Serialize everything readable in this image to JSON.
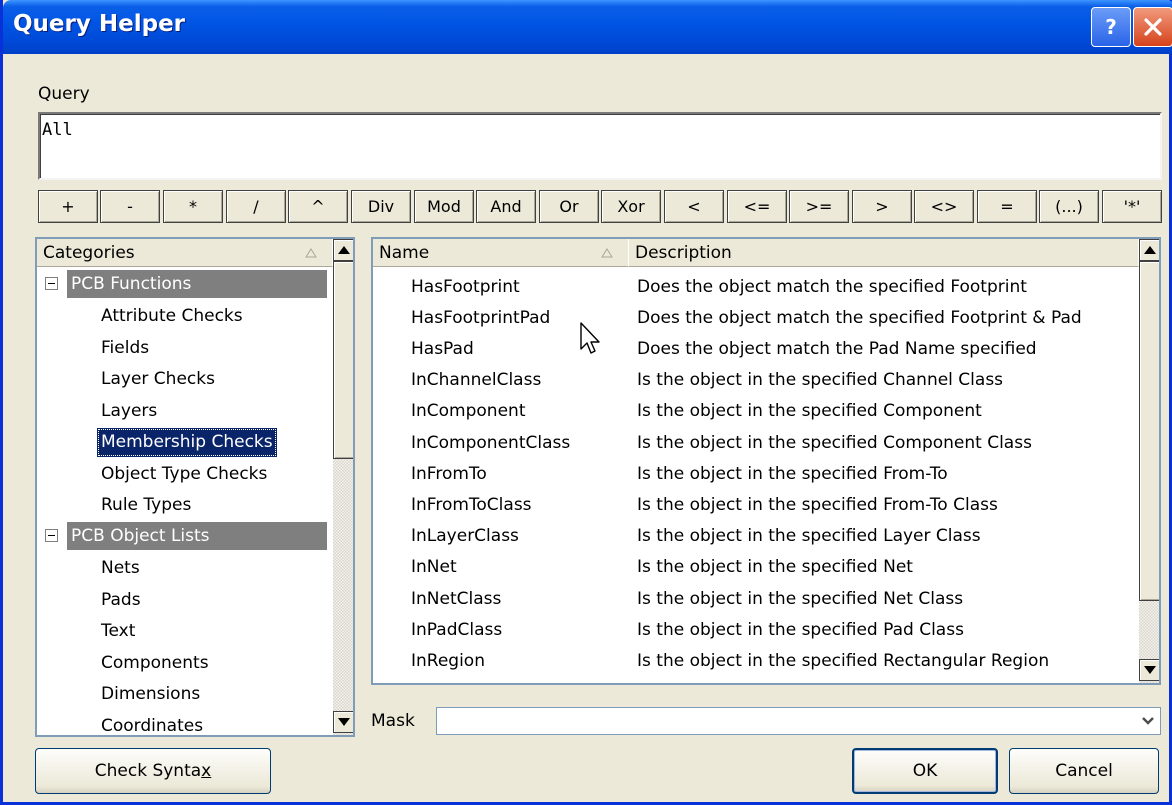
{
  "window": {
    "title": "Query Helper"
  },
  "query": {
    "label": "Query",
    "value": "All"
  },
  "operators": [
    "+",
    "-",
    "*",
    "/",
    "^",
    "Div",
    "Mod",
    "And",
    "Or",
    "Xor",
    "<",
    "<=",
    ">=",
    ">",
    "<>",
    "=",
    "(...)",
    "'*'"
  ],
  "categories": {
    "header": "Categories",
    "groups": [
      {
        "label": "PCB Functions",
        "items": [
          "Attribute Checks",
          "Fields",
          "Layer Checks",
          "Layers",
          "Membership Checks",
          "Object Type Checks",
          "Rule Types"
        ]
      },
      {
        "label": "PCB Object Lists",
        "items": [
          "Nets",
          "Pads",
          "Text",
          "Components",
          "Dimensions",
          "Coordinates"
        ]
      }
    ],
    "selected": "Membership Checks"
  },
  "functions": {
    "columns": {
      "name": "Name",
      "description": "Description"
    },
    "rows": [
      {
        "name": "HasFootprint",
        "description": "Does the object match the specified Footprint"
      },
      {
        "name": "HasFootprintPad",
        "description": "Does the object match the specified Footprint & Pad"
      },
      {
        "name": "HasPad",
        "description": "Does the object match the Pad Name specified"
      },
      {
        "name": "InChannelClass",
        "description": "Is the object in the specified Channel Class"
      },
      {
        "name": "InComponent",
        "description": "Is the object in the specified Component"
      },
      {
        "name": "InComponentClass",
        "description": "Is the object in the specified Component Class"
      },
      {
        "name": "InFromTo",
        "description": "Is the object in the specified From-To"
      },
      {
        "name": "InFromToClass",
        "description": "Is the object in the specified From-To Class"
      },
      {
        "name": "InLayerClass",
        "description": "Is the object in the specified Layer Class"
      },
      {
        "name": "InNet",
        "description": "Is the object in the specified Net"
      },
      {
        "name": "InNetClass",
        "description": "Is the object in the specified Net Class"
      },
      {
        "name": "InPadClass",
        "description": "Is the object in the specified Pad Class"
      },
      {
        "name": "InRegion",
        "description": "Is the object in the specified Rectangular Region"
      }
    ]
  },
  "mask": {
    "label": "Mask",
    "value": ""
  },
  "buttons": {
    "check_syntax_pre": "Check Synta",
    "check_syntax_ul": "x",
    "ok": "OK",
    "cancel": "Cancel"
  },
  "colors": {
    "title_bar": "#0054e3",
    "selection": "#0a246a",
    "group_header": "#7f7f7f",
    "face": "#ece9d8"
  }
}
